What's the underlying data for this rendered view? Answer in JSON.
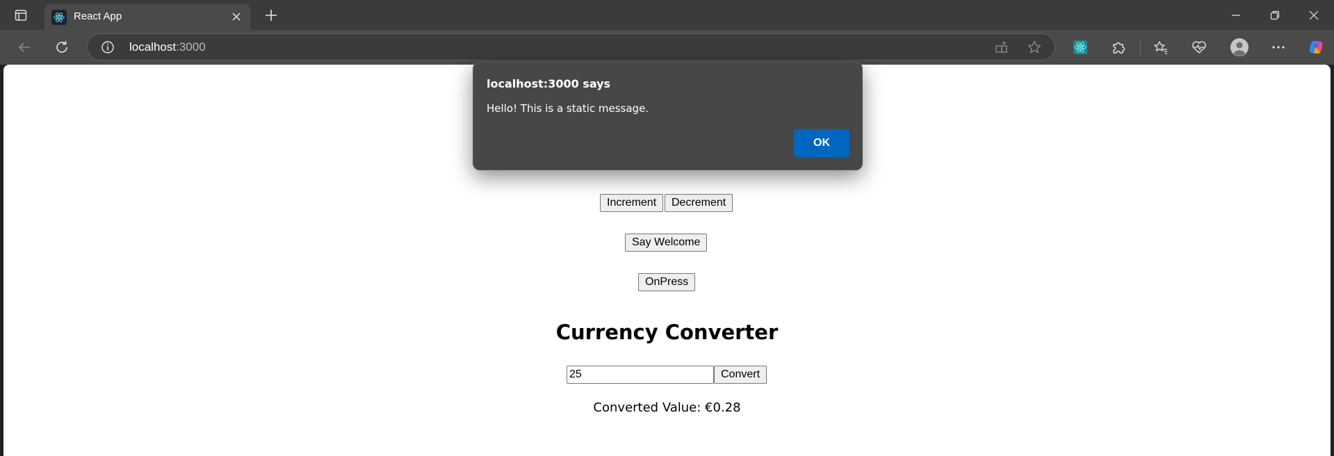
{
  "browser": {
    "tab": {
      "title": "React App",
      "favicon": "react-icon"
    },
    "address": {
      "host": "localhost",
      "port": ":3000"
    },
    "icons": {
      "tab_actions": "tab-actions-icon",
      "new_tab": "plus-icon",
      "back": "back-arrow-icon",
      "refresh": "refresh-icon",
      "site_info": "info-icon",
      "app_install": "app-install-icon",
      "favorite": "star-icon",
      "react_devtools": "react-devtools-icon",
      "extensions": "puzzle-icon",
      "favorites": "favorites-icon",
      "browser_essentials": "heart-pulse-icon",
      "profile": "profile-icon",
      "more": "more-icon",
      "copilot": "copilot-icon"
    }
  },
  "page": {
    "buttons": {
      "increment": "Increment",
      "decrement": "Decrement",
      "say_welcome": "Say Welcome",
      "onpress": "OnPress"
    },
    "currency": {
      "heading": "Currency Converter",
      "amount_value": "25",
      "convert_label": "Convert",
      "result": "Converted Value: €0.28"
    }
  },
  "dialog": {
    "title": "localhost:3000 says",
    "message": "Hello! This is a static message.",
    "ok_label": "OK"
  },
  "colors": {
    "dialog_ok": "#0067c0",
    "chrome_dark": "#3b3b3b",
    "toolbar": "#4a4a4a"
  }
}
